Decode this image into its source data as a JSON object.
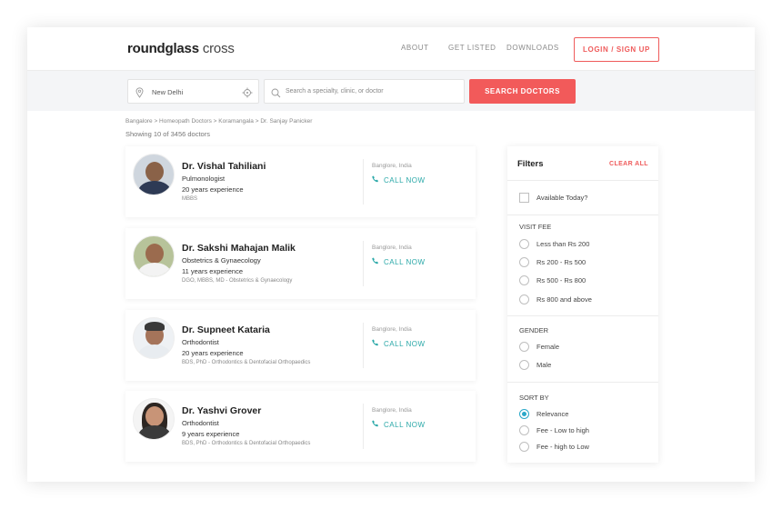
{
  "header": {
    "logo_bold": "roundglass",
    "logo_light": " cross",
    "nav": [
      "ABOUT",
      "GET LISTED",
      "DOWNLOADS"
    ],
    "login_label": "LOGIN / SIGN UP"
  },
  "search": {
    "location_value": "New Delhi",
    "query_placeholder": "Search a specialty, clinic, or doctor",
    "button_label": "SEARCH DOCTORS"
  },
  "breadcrumb": "Bangalore > Homeopath Doctors > Koramangala > Dr. Sanjay Panicker",
  "results_count": "Showing 10 of 3456 doctors",
  "doctors": [
    {
      "name": "Dr. Vishal Tahiliani",
      "specialty": "Pulmonologist",
      "experience": "20 years experience",
      "degrees": "MBBS",
      "city": "Banglore, India",
      "call_label": "CALL NOW"
    },
    {
      "name": "Dr. Sakshi Mahajan Malik",
      "specialty": "Obstetrics & Gynaecology",
      "experience": "11 years experience",
      "degrees": "DGO, MBBS, MD - Obstetrics & Gynaecology",
      "city": "Banglore, India",
      "call_label": "CALL NOW"
    },
    {
      "name": "Dr. Supneet Kataria",
      "specialty": "Orthodontist",
      "experience": "20 years experience",
      "degrees": "BDS, PhD - Orthodontics & Dentofacial Orthopaedics",
      "city": "Banglore, India",
      "call_label": "CALL NOW"
    },
    {
      "name": "Dr. Yashvi Grover",
      "specialty": "Orthodontist",
      "experience": "9 years experience",
      "degrees": "BDS, PhD - Orthodontics & Dentofacial Orthopaedics",
      "city": "Banglore, India",
      "call_label": "CALL NOW"
    }
  ],
  "filters": {
    "title": "Filters",
    "clear_label": "CLEAR ALL",
    "available_today": "Available Today?",
    "visit_fee": {
      "label": "VISIT FEE",
      "options": [
        "Less than Rs 200",
        "Rs 200 - Rs 500",
        "Rs 500 - Rs 800",
        "Rs 800 and above"
      ]
    },
    "gender": {
      "label": "GENDER",
      "options": [
        "Female",
        "Male"
      ]
    },
    "sort_by": {
      "label": "SORT BY",
      "options": [
        "Relevance",
        "Fee - Low to high",
        "Fee - high to Low"
      ],
      "selected": "Relevance"
    }
  },
  "colors": {
    "accent": "#f25a5a",
    "teal": "#2aa8a8",
    "band": "#f4f5f7"
  }
}
